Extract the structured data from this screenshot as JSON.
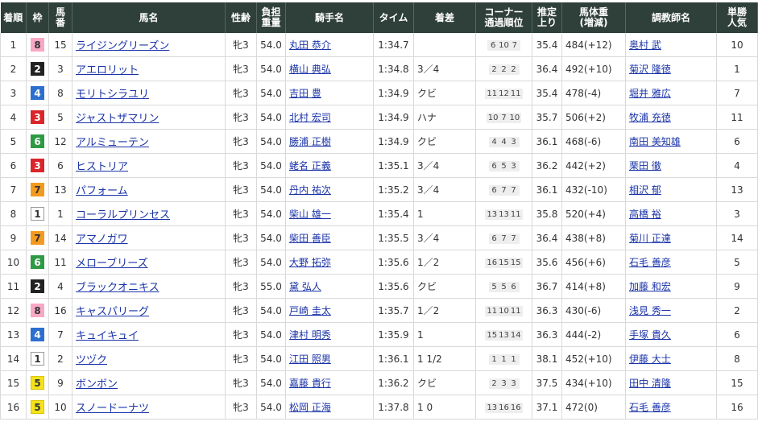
{
  "headers": {
    "rank": "着順",
    "waku": "枠",
    "umaban": [
      "馬",
      "番"
    ],
    "horse": "馬名",
    "sexage": "性齢",
    "weight": [
      "負担",
      "重量"
    ],
    "jockey": "騎手名",
    "time": "タイム",
    "margin": "着差",
    "corner": [
      "コーナー",
      "通過順位"
    ],
    "last3f": [
      "推定",
      "上り"
    ],
    "body": [
      "馬体重",
      "(増減)"
    ],
    "trainer": "調教師名",
    "pop": [
      "単勝",
      "人気"
    ]
  },
  "waku_colors": {
    "1": {
      "bg": "#ffffff",
      "fg": "#333333",
      "border": "#999999"
    },
    "2": {
      "bg": "#222222",
      "fg": "#ffffff",
      "border": "#222222"
    },
    "3": {
      "bg": "#d9262a",
      "fg": "#ffffff",
      "border": "#d9262a"
    },
    "4": {
      "bg": "#2c6fcf",
      "fg": "#ffffff",
      "border": "#2c6fcf"
    },
    "5": {
      "bg": "#f5e21b",
      "fg": "#333333",
      "border": "#d8c600"
    },
    "6": {
      "bg": "#2e9a44",
      "fg": "#ffffff",
      "border": "#2e9a44"
    },
    "7": {
      "bg": "#f49a1f",
      "fg": "#333333",
      "border": "#f49a1f"
    },
    "8": {
      "bg": "#f7a8c4",
      "fg": "#333333",
      "border": "#f7a8c4"
    }
  },
  "rows": [
    {
      "rank": "1",
      "waku": "8",
      "umaban": "15",
      "horse": "ライジングリーズン",
      "sexage": "牝3",
      "weight": "54.0",
      "jockey": "丸田 恭介",
      "time": "1:34.7",
      "margin": "",
      "corners": [
        "6",
        "10",
        "7"
      ],
      "last3f": "35.4",
      "body": "484",
      "body_diff": "(+12)",
      "trainer": "奥村 武",
      "pop": "10"
    },
    {
      "rank": "2",
      "waku": "2",
      "umaban": "3",
      "horse": "アエロリット",
      "sexage": "牝3",
      "weight": "54.0",
      "jockey": "横山 典弘",
      "time": "1:34.8",
      "margin": "3／4",
      "corners": [
        "2",
        "2",
        "2"
      ],
      "last3f": "36.4",
      "body": "492",
      "body_diff": "(+10)",
      "trainer": "菊沢 隆徳",
      "pop": "1"
    },
    {
      "rank": "3",
      "waku": "4",
      "umaban": "8",
      "horse": "モリトシラユリ",
      "sexage": "牝3",
      "weight": "54.0",
      "jockey": "吉田 豊",
      "time": "1:34.9",
      "margin": "クビ",
      "corners": [
        "11",
        "12",
        "11"
      ],
      "last3f": "35.4",
      "body": "478",
      "body_diff": "(-4)",
      "trainer": "堀井 雅広",
      "pop": "7"
    },
    {
      "rank": "4",
      "waku": "3",
      "umaban": "5",
      "horse": "ジャストザマリン",
      "sexage": "牝3",
      "weight": "54.0",
      "jockey": "北村 宏司",
      "time": "1:34.9",
      "margin": "ハナ",
      "corners": [
        "10",
        "7",
        "10"
      ],
      "last3f": "35.7",
      "body": "506",
      "body_diff": "(+2)",
      "trainer": "牧浦 充徳",
      "pop": "11"
    },
    {
      "rank": "5",
      "waku": "6",
      "umaban": "12",
      "horse": "アルミューテン",
      "sexage": "牝3",
      "weight": "54.0",
      "jockey": "勝浦 正樹",
      "time": "1:34.9",
      "margin": "クビ",
      "corners": [
        "4",
        "4",
        "3"
      ],
      "last3f": "36.1",
      "body": "468",
      "body_diff": "(-6)",
      "trainer": "南田 美知雄",
      "pop": "6"
    },
    {
      "rank": "6",
      "waku": "3",
      "umaban": "6",
      "horse": "ヒストリア",
      "sexage": "牝3",
      "weight": "54.0",
      "jockey": "蛯名 正義",
      "time": "1:35.1",
      "margin": "3／4",
      "corners": [
        "6",
        "5",
        "3"
      ],
      "last3f": "36.2",
      "body": "442",
      "body_diff": "(+2)",
      "trainer": "栗田 徹",
      "pop": "4"
    },
    {
      "rank": "7",
      "waku": "7",
      "umaban": "13",
      "horse": "パフォーム",
      "sexage": "牝3",
      "weight": "54.0",
      "jockey": "丹内 祐次",
      "time": "1:35.2",
      "margin": "3／4",
      "corners": [
        "6",
        "7",
        "7"
      ],
      "last3f": "36.1",
      "body": "432",
      "body_diff": "(-10)",
      "trainer": "相沢 郁",
      "pop": "13"
    },
    {
      "rank": "8",
      "waku": "1",
      "umaban": "1",
      "horse": "コーラルプリンセス",
      "sexage": "牝3",
      "weight": "54.0",
      "jockey": "柴山 雄一",
      "time": "1:35.4",
      "margin": "1",
      "corners": [
        "13",
        "13",
        "11"
      ],
      "last3f": "35.8",
      "body": "520",
      "body_diff": "(+4)",
      "trainer": "高橋 裕",
      "pop": "3"
    },
    {
      "rank": "9",
      "waku": "7",
      "umaban": "14",
      "horse": "アマノガワ",
      "sexage": "牝3",
      "weight": "54.0",
      "jockey": "柴田 善臣",
      "time": "1:35.5",
      "margin": "3／4",
      "corners": [
        "6",
        "7",
        "7"
      ],
      "last3f": "36.4",
      "body": "438",
      "body_diff": "(+8)",
      "trainer": "菊川 正達",
      "pop": "14"
    },
    {
      "rank": "10",
      "waku": "6",
      "umaban": "11",
      "horse": "メローブリーズ",
      "sexage": "牝3",
      "weight": "54.0",
      "jockey": "大野 拓弥",
      "time": "1:35.6",
      "margin": "1／2",
      "corners": [
        "16",
        "15",
        "15"
      ],
      "last3f": "35.6",
      "body": "456",
      "body_diff": "(+6)",
      "trainer": "石毛 善彦",
      "pop": "5"
    },
    {
      "rank": "11",
      "waku": "2",
      "umaban": "4",
      "horse": "ブラックオニキス",
      "sexage": "牝3",
      "weight": "55.0",
      "jockey": "黛 弘人",
      "time": "1:35.6",
      "margin": "クビ",
      "corners": [
        "5",
        "5",
        "6"
      ],
      "last3f": "36.7",
      "body": "414",
      "body_diff": "(+8)",
      "trainer": "加藤 和宏",
      "pop": "9"
    },
    {
      "rank": "12",
      "waku": "8",
      "umaban": "16",
      "horse": "キャスパリーグ",
      "sexage": "牝3",
      "weight": "54.0",
      "jockey": "戸崎 圭太",
      "time": "1:35.7",
      "margin": "1／2",
      "corners": [
        "11",
        "10",
        "11"
      ],
      "last3f": "36.3",
      "body": "430",
      "body_diff": "(-6)",
      "trainer": "浅見 秀一",
      "pop": "2"
    },
    {
      "rank": "13",
      "waku": "4",
      "umaban": "7",
      "horse": "キュイキュイ",
      "sexage": "牝3",
      "weight": "54.0",
      "jockey": "津村 明秀",
      "time": "1:35.9",
      "margin": "1",
      "corners": [
        "15",
        "13",
        "14"
      ],
      "last3f": "36.3",
      "body": "444",
      "body_diff": "(-2)",
      "trainer": "手塚 貴久",
      "pop": "6"
    },
    {
      "rank": "14",
      "waku": "1",
      "umaban": "2",
      "horse": "ツヅク",
      "sexage": "牝3",
      "weight": "54.0",
      "jockey": "江田 照男",
      "time": "1:36.1",
      "margin": "1 1/2",
      "corners": [
        "1",
        "1",
        "1"
      ],
      "last3f": "38.1",
      "body": "452",
      "body_diff": "(+10)",
      "trainer": "伊藤 大士",
      "pop": "8"
    },
    {
      "rank": "15",
      "waku": "5",
      "umaban": "9",
      "horse": "ボンボン",
      "sexage": "牝3",
      "weight": "54.0",
      "jockey": "嘉藤 貴行",
      "time": "1:36.2",
      "margin": "クビ",
      "corners": [
        "2",
        "3",
        "3"
      ],
      "last3f": "37.5",
      "body": "434",
      "body_diff": "(+10)",
      "trainer": "田中 清隆",
      "pop": "15"
    },
    {
      "rank": "16",
      "waku": "5",
      "umaban": "10",
      "horse": "スノードーナツ",
      "sexage": "牝3",
      "weight": "54.0",
      "jockey": "松岡 正海",
      "time": "1:37.8",
      "margin": "1 0",
      "corners": [
        "13",
        "16",
        "16"
      ],
      "last3f": "37.1",
      "body": "472",
      "body_diff": "(0)",
      "trainer": "石毛 善彦",
      "pop": "16"
    }
  ]
}
